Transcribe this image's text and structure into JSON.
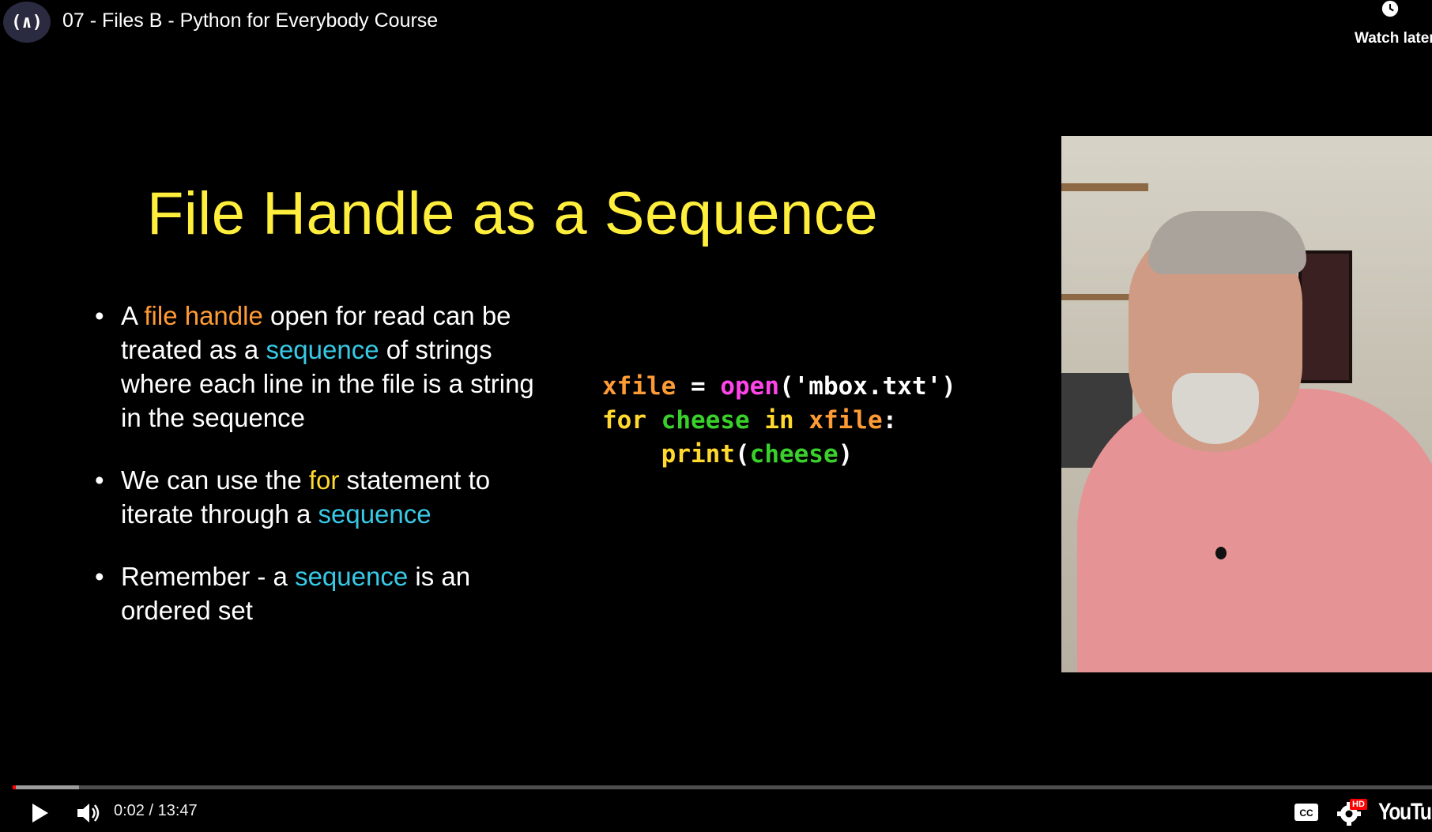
{
  "header": {
    "channel_avatar_glyph": "(∧)",
    "title": "07 - Files B - Python for Everybody Course",
    "watch_later_label": "Watch later",
    "watch_later_icon": "clock-icon"
  },
  "slide": {
    "title": "File Handle as a Sequence",
    "bullets": [
      {
        "parts": [
          {
            "text": "A ",
            "color": "white"
          },
          {
            "text": "file handle",
            "color": "orange"
          },
          {
            "text": " open for read can be treated as a ",
            "color": "white"
          },
          {
            "text": "sequence",
            "color": "cyan"
          },
          {
            "text": " of strings where each line in the file is a string in the sequence",
            "color": "white"
          }
        ]
      },
      {
        "parts": [
          {
            "text": "We can use the ",
            "color": "white"
          },
          {
            "text": "for",
            "color": "yellow"
          },
          {
            "text": " statement to iterate through a ",
            "color": "white"
          },
          {
            "text": "sequence",
            "color": "cyan"
          }
        ]
      },
      {
        "parts": [
          {
            "text": "Remember - a ",
            "color": "white"
          },
          {
            "text": "sequence",
            "color": "cyan"
          },
          {
            "text": " is an ordered set",
            "color": "white"
          }
        ]
      }
    ],
    "code_lines": [
      [
        {
          "text": "xfile",
          "color": "orange"
        },
        {
          "text": " = ",
          "color": "white"
        },
        {
          "text": "open",
          "color": "magenta"
        },
        {
          "text": "('mbox.txt')",
          "color": "white"
        }
      ],
      [
        {
          "text": "for",
          "color": "yellow"
        },
        {
          "text": " ",
          "color": "white"
        },
        {
          "text": "cheese",
          "color": "green"
        },
        {
          "text": " in ",
          "color": "yellow"
        },
        {
          "text": "xfile",
          "color": "orange"
        },
        {
          "text": ":",
          "color": "white"
        }
      ],
      [
        {
          "text": "    print",
          "color": "yellow"
        },
        {
          "text": "(",
          "color": "white"
        },
        {
          "text": "cheese",
          "color": "green"
        },
        {
          "text": ")",
          "color": "white"
        }
      ]
    ]
  },
  "controls": {
    "current_time": "0:02",
    "separator": " / ",
    "duration": "13:47",
    "played_fraction": 0.0024,
    "buffered_fraction": 0.047,
    "hd_badge": "HD",
    "logo_text": "YouTube",
    "play_icon": "play-icon",
    "volume_icon": "volume-icon",
    "cc_icon": "closed-captions-icon",
    "settings_icon": "gear-icon"
  },
  "colors": {
    "orange": "#ff9b35",
    "cyan": "#38c9e6",
    "yellow": "#ffd92e",
    "magenta": "#ff44e9",
    "green": "#3ad02b",
    "white": "#ffffff",
    "title_yellow": "#ffee3c",
    "progress_red": "#ff0000"
  }
}
